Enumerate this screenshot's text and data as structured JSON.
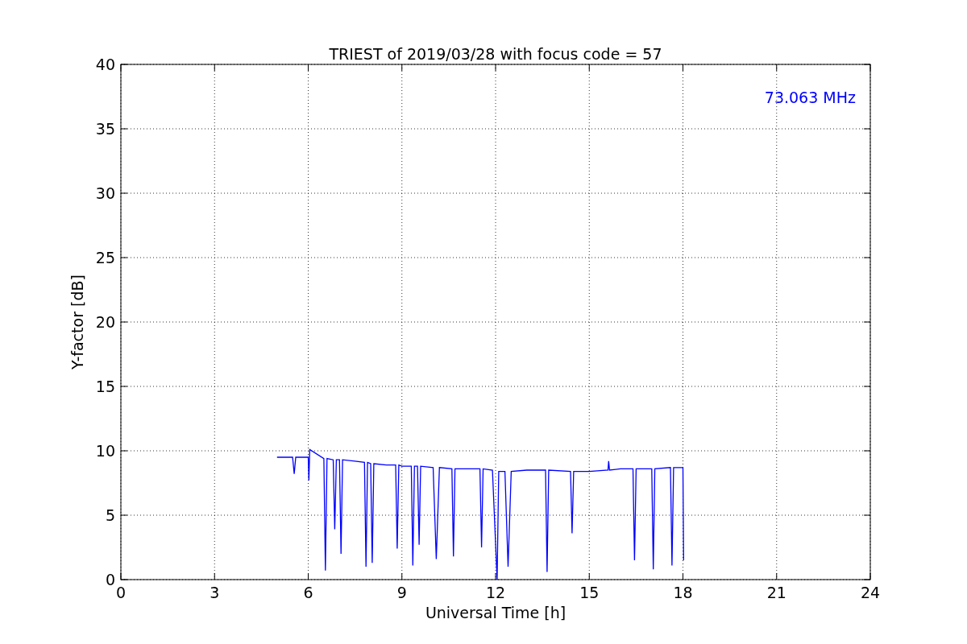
{
  "chart_data": {
    "type": "line",
    "title": "TRIEST of 2019/03/28 with focus code = 57",
    "xlabel": "Universal Time [h]",
    "ylabel": "Y-factor [dB]",
    "x": [
      5,
      5.5,
      5.55,
      5.6,
      6,
      6.02,
      6.05,
      6.5,
      6.55,
      6.6,
      6.8,
      6.85,
      6.9,
      7,
      7.05,
      7.1,
      7.5,
      7.8,
      7.85,
      7.9,
      8,
      8.05,
      8.1,
      8.5,
      8.8,
      8.85,
      8.9,
      9,
      9.3,
      9.35,
      9.4,
      9.5,
      9.55,
      9.6,
      10,
      10.1,
      10.2,
      10.6,
      10.65,
      10.7,
      11.3,
      11.5,
      11.55,
      11.6,
      11.9,
      12.05,
      12.1,
      12.3,
      12.4,
      12.5,
      13,
      13.6,
      13.65,
      13.7,
      14.4,
      14.45,
      14.5,
      15,
      15.6,
      15.62,
      15.65,
      16,
      16.4,
      16.45,
      16.5,
      17,
      17.05,
      17.1,
      17.6,
      17.65,
      17.7,
      18,
      18.02
    ],
    "series": [
      {
        "name": "73.063 MHz",
        "color": "#0000ff",
        "values": [
          9.5,
          9.5,
          8.2,
          9.5,
          9.5,
          7.7,
          10.1,
          9.4,
          0.7,
          9.4,
          9.3,
          3.9,
          9.3,
          9.3,
          2.0,
          9.3,
          9.2,
          9.1,
          1.0,
          9.1,
          9.0,
          1.3,
          9.0,
          8.9,
          8.9,
          2.4,
          8.9,
          8.8,
          8.8,
          1.1,
          8.8,
          8.8,
          2.7,
          8.8,
          8.7,
          1.6,
          8.7,
          8.6,
          1.8,
          8.6,
          8.6,
          8.6,
          2.5,
          8.6,
          8.5,
          0.0,
          8.4,
          8.4,
          1.0,
          8.4,
          8.5,
          8.5,
          0.6,
          8.5,
          8.4,
          3.6,
          8.4,
          8.4,
          8.5,
          9.2,
          8.5,
          8.6,
          8.6,
          1.5,
          8.6,
          8.6,
          0.8,
          8.6,
          8.7,
          1.1,
          8.7,
          8.7,
          1.5
        ]
      }
    ],
    "xlim": [
      0,
      24
    ],
    "ylim": [
      0,
      40
    ],
    "xticks": [
      0,
      3,
      6,
      9,
      12,
      15,
      18,
      21,
      24
    ],
    "yticks": [
      0,
      5,
      10,
      15,
      20,
      25,
      30,
      35,
      40
    ],
    "grid": true
  }
}
